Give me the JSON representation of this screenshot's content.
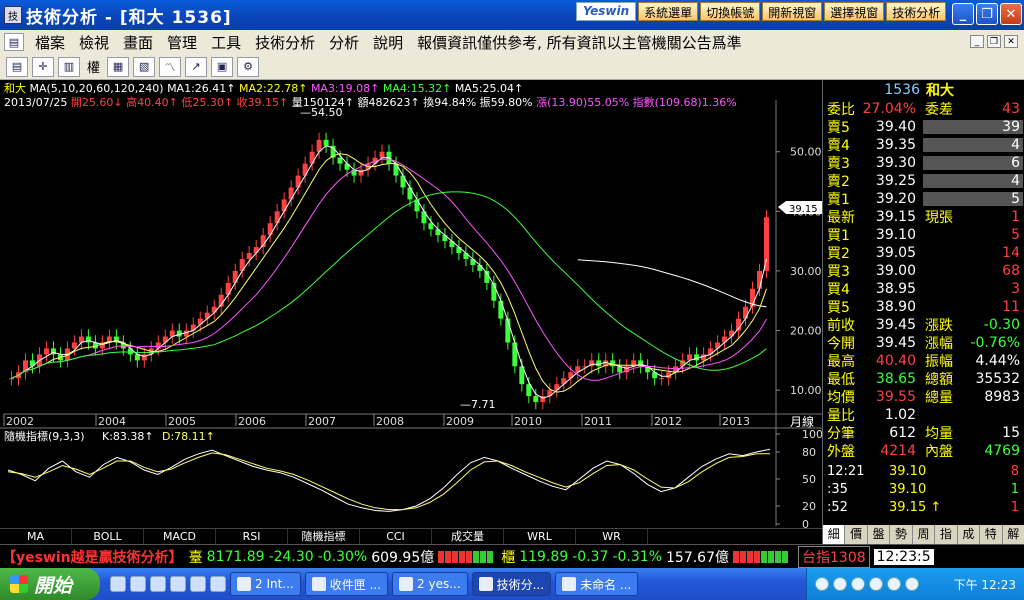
{
  "window": {
    "title": "技術分析 - [和大 1536]",
    "brand": "Yeswin",
    "top_buttons": [
      "系統選單",
      "切換帳號",
      "開新視窗",
      "選擇視窗",
      "技術分析"
    ]
  },
  "menu": [
    "檔案",
    "檢視",
    "畫面",
    "管理",
    "工具",
    "技術分析",
    "分析",
    "說明",
    "報價資訊僅供參考, 所有資訊以主管機關公告爲準"
  ],
  "toolbar": {
    "label": "權"
  },
  "chart_info": {
    "name": "和大",
    "ma_spec": "MA(5,10,20,60,120,240)",
    "ma1": "MA1:26.41↑",
    "ma2": "MA2:22.78↑",
    "ma3": "MA3:19.08↑",
    "ma4": "MA4:15.32↑",
    "ma5": "MA5:25.04↑",
    "date": "2013/07/25",
    "open": "開25.60↓",
    "high": "高40.40↑",
    "low": "低25.30↑",
    "close": "收39.15↑",
    "vol": "量150124↑",
    "amt": "額482623↑",
    "turnover": "換94.84%",
    "amp": "振59.80%",
    "chg": "漲(13.90)55.05%",
    "idx": "指數(109.68)1.36%",
    "high_marker": "54.50",
    "low_marker": "7.71",
    "price_tag": "39.15",
    "axis_unit": "月線"
  },
  "chart_data": [
    {
      "type": "candlestick",
      "x_labels": [
        "2002",
        "2004",
        "2005",
        "2006",
        "2007",
        "2008",
        "2009",
        "2010",
        "2011",
        "2012",
        "2013"
      ],
      "y_ticks": [
        "50.00",
        "40.00",
        "30.00",
        "20.00",
        "10.00"
      ],
      "ylim": [
        6,
        57
      ],
      "close_series": [
        12,
        13,
        15,
        14,
        16,
        17,
        16,
        15,
        17,
        18,
        19,
        18,
        17,
        18,
        19,
        18,
        17,
        16,
        15,
        16,
        17,
        18,
        19,
        20,
        19,
        20,
        21,
        22,
        23,
        24,
        26,
        28,
        30,
        32,
        33,
        34,
        36,
        38,
        40,
        42,
        44,
        46,
        48,
        50,
        52,
        51,
        49,
        48,
        47,
        46,
        47,
        48,
        49,
        50,
        48,
        46,
        44,
        42,
        40,
        38,
        37,
        36,
        35,
        34,
        33,
        32,
        31,
        30,
        28,
        25,
        22,
        18,
        14,
        11,
        9,
        8,
        9,
        10,
        11,
        12,
        13,
        14,
        14,
        15,
        14,
        15,
        14,
        13,
        14,
        15,
        14,
        13,
        12,
        12,
        13,
        14,
        15,
        16,
        15,
        16,
        17,
        18,
        19,
        20,
        22,
        24,
        27,
        30,
        39
      ],
      "ma_lines": [
        {
          "name": "MA1",
          "color": "#ffffff"
        },
        {
          "name": "MA2",
          "color": "#ffff66"
        },
        {
          "name": "MA3",
          "color": "#ff55ff"
        },
        {
          "name": "MA4",
          "color": "#3cff3c"
        },
        {
          "name": "MA5",
          "color": "#ffffff"
        }
      ]
    },
    {
      "type": "line",
      "title": "隨機指標(9,3,3)",
      "k_label": "K:83.38↑",
      "d_label": "D:78.11↑",
      "y_ticks": [
        "100",
        "80",
        "50",
        "20",
        "0"
      ],
      "ylim": [
        0,
        100
      ],
      "series": [
        {
          "name": "K",
          "values": [
            60,
            55,
            48,
            62,
            70,
            58,
            52,
            66,
            74,
            69,
            60,
            55,
            63,
            72,
            78,
            82,
            76,
            70,
            64,
            60,
            57,
            52,
            45,
            38,
            30,
            22,
            18,
            15,
            14,
            16,
            20,
            28,
            40,
            55,
            68,
            74,
            70,
            62,
            55,
            48,
            42,
            38,
            50,
            62,
            70,
            66,
            56,
            44,
            36,
            40,
            52,
            64,
            72,
            78,
            76,
            80,
            83
          ]
        },
        {
          "name": "D",
          "values": [
            58,
            56,
            52,
            58,
            65,
            61,
            55,
            62,
            70,
            70,
            63,
            58,
            61,
            68,
            74,
            79,
            77,
            72,
            67,
            62,
            59,
            55,
            49,
            42,
            35,
            28,
            22,
            18,
            16,
            16,
            18,
            24,
            33,
            46,
            60,
            69,
            70,
            65,
            58,
            52,
            46,
            41,
            46,
            56,
            65,
            66,
            60,
            50,
            41,
            40,
            47,
            58,
            67,
            74,
            75,
            78,
            78
          ]
        }
      ]
    }
  ],
  "panel": {
    "code": "1536",
    "name": "和大",
    "ratio_label": "委比",
    "ratio_value": "27.04%",
    "diff_label": "委差",
    "diff_value": "43",
    "asks": [
      {
        "label": "賣5",
        "price": "39.40",
        "qty": "39"
      },
      {
        "label": "賣4",
        "price": "39.35",
        "qty": "4"
      },
      {
        "label": "賣3",
        "price": "39.30",
        "qty": "6"
      },
      {
        "label": "賣2",
        "price": "39.25",
        "qty": "4"
      },
      {
        "label": "賣1",
        "price": "39.20",
        "qty": "5"
      }
    ],
    "last_label": "最新",
    "last_price": "39.15",
    "cur_label": "現張",
    "cur_qty": "1",
    "bids": [
      {
        "label": "買1",
        "price": "39.10",
        "qty": "5"
      },
      {
        "label": "買2",
        "price": "39.05",
        "qty": "14"
      },
      {
        "label": "買3",
        "price": "39.00",
        "qty": "68"
      },
      {
        "label": "買4",
        "price": "38.95",
        "qty": "3"
      },
      {
        "label": "買5",
        "price": "38.90",
        "qty": "11"
      }
    ],
    "stats": [
      {
        "l1": "前收",
        "v1": "39.45",
        "l2": "漲跌",
        "v2": "-0.30",
        "c1": "#ffffff",
        "c2": "#3cff3c"
      },
      {
        "l1": "今開",
        "v1": "39.45",
        "l2": "漲幅",
        "v2": "-0.76%",
        "c1": "#ffffff",
        "c2": "#3cff3c"
      },
      {
        "l1": "最高",
        "v1": "40.40",
        "l2": "振幅",
        "v2": "4.44%",
        "c1": "#ff4040",
        "c2": "#ffffff"
      },
      {
        "l1": "最低",
        "v1": "38.65",
        "l2": "總額",
        "v2": "35532",
        "c1": "#3cff3c",
        "c2": "#ffffff"
      },
      {
        "l1": "均價",
        "v1": "39.55",
        "l2": "總量",
        "v2": "8983",
        "c1": "#ff4040",
        "c2": "#ffffff"
      },
      {
        "l1": "量比",
        "v1": "1.02",
        "l2": "",
        "v2": "",
        "c1": "#ffffff",
        "c2": "#ffffff"
      },
      {
        "l1": "分筆",
        "v1": "612",
        "l2": "均量",
        "v2": "15",
        "c1": "#ffffff",
        "c2": "#ffffff"
      },
      {
        "l1": "外盤",
        "v1": "4214",
        "l2": "內盤",
        "v2": "4769",
        "c1": "#ff4040",
        "c2": "#3cff3c"
      }
    ],
    "ticks": [
      {
        "time": "12:21",
        "price": "39.10",
        "qty": "8",
        "qc": "#ff4040"
      },
      {
        "time": ":35",
        "price": "39.10",
        "qty": "1",
        "qc": "#3cff3c"
      },
      {
        "time": ":52",
        "price": "39.15 ↑",
        "qty": "1",
        "qc": "#ff4040"
      }
    ],
    "tabs": [
      "細",
      "價",
      "盤",
      "勢",
      "周",
      "指",
      "成",
      "特",
      "解"
    ]
  },
  "indicator_tabs": [
    "MA",
    "BOLL",
    "MACD",
    "RSI",
    "隨機指標",
    "CCI",
    "成交量",
    "WRL",
    "WR"
  ],
  "ticker": {
    "brand": "【yeswin越是贏技術分析】",
    "m1_label": "臺",
    "m1_val": "8171.89",
    "m1_chg": "-24.30",
    "m1_pct": "-0.30%",
    "m1_amt": "609.95億",
    "m2_label": "櫃",
    "m2_val": "119.89",
    "m2_chg": "-0.37",
    "m2_pct": "-0.31%",
    "m2_amt": "157.67億",
    "idx_name": "台指1308",
    "time": "12:23:5"
  },
  "taskbar": {
    "start": "開始",
    "tasks": [
      "2 Int...",
      "收件匣 ...",
      "2 yes...",
      "技術分...",
      "未命名 ..."
    ],
    "clock": "下午 12:23"
  }
}
